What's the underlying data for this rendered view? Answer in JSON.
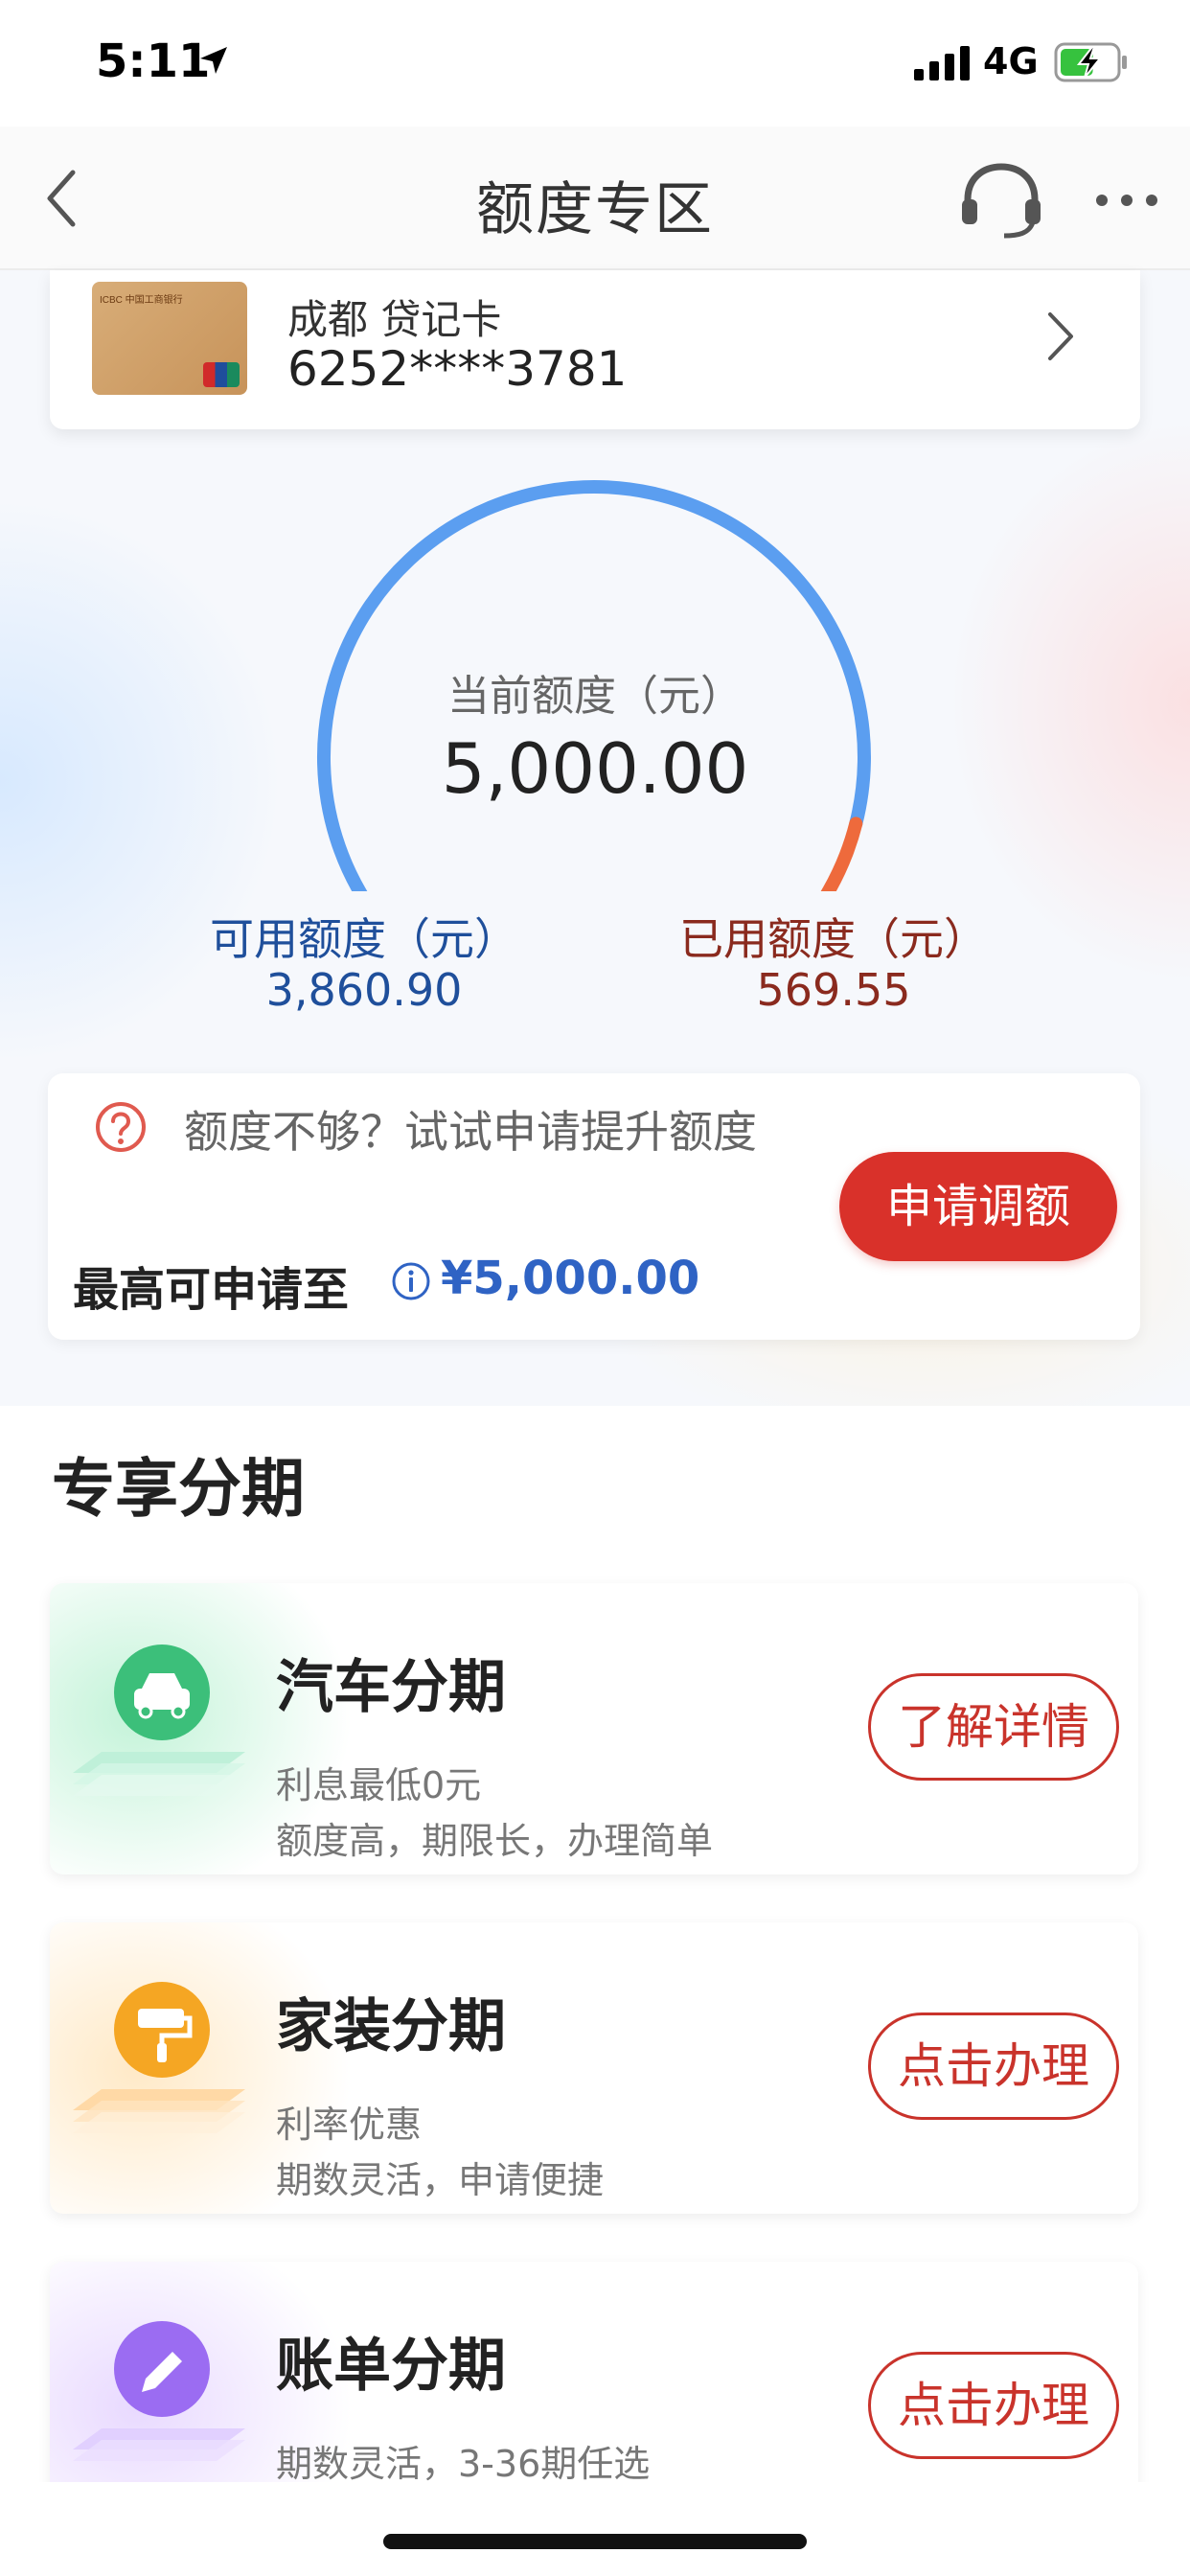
{
  "status_bar": {
    "time": "5:11",
    "network": "4G",
    "battery_level": 0.6
  },
  "nav": {
    "title": "额度专区"
  },
  "card": {
    "name": "成都 贷记卡",
    "number": "6252****3781",
    "bank_mark": "ICBC 中国工商银行"
  },
  "limits": {
    "current_label": "当前额度（元）",
    "current_value": "5,000.00",
    "available_label": "可用额度（元）",
    "available_value": "3,860.90",
    "used_label": "已用额度（元）",
    "used_value": "569.55",
    "used_fraction": 0.1139,
    "colors": {
      "available": "#5b9ef0",
      "used": "#ee6a3c"
    }
  },
  "increase": {
    "prompt": "额度不够？试试申请提升额度",
    "max_label": "最高可申请至",
    "max_value": "¥5,000.00",
    "button_label": "申请调额"
  },
  "installments": {
    "section_title": "专享分期",
    "items": [
      {
        "title": "汽车分期",
        "line1": "利息最低0元",
        "line2": "额度高，期限长，办理简单",
        "button": "了解详情",
        "icon": "car-icon",
        "color": "#3cbf7a"
      },
      {
        "title": "家装分期",
        "line1": "利率优惠",
        "line2": "期数灵活，申请便捷",
        "button": "点击办理",
        "icon": "paint-roller-icon",
        "color": "#f5a623"
      },
      {
        "title": "账单分期",
        "line1": "期数灵活，3-36期任选",
        "line2": "",
        "button": "点击办理",
        "icon": "pencil-icon",
        "color": "#9b6cf2"
      }
    ]
  }
}
